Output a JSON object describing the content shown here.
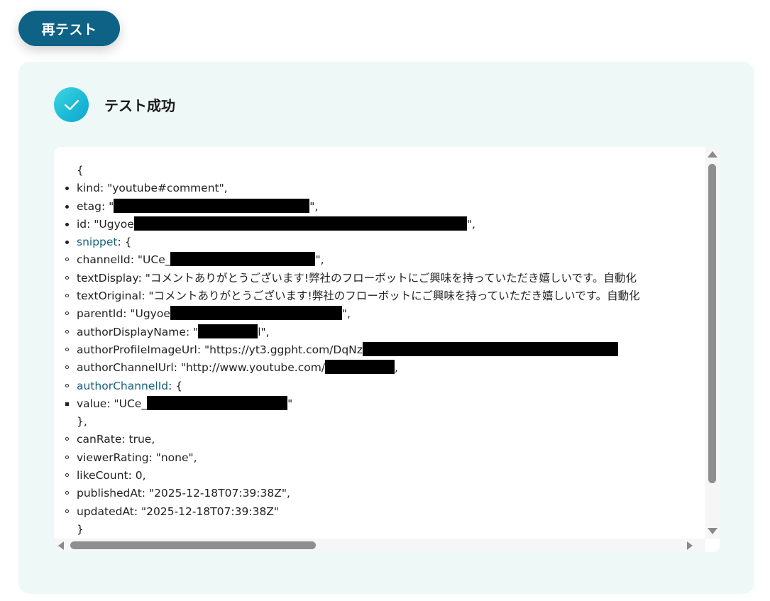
{
  "retest_button": {
    "label": "再テスト"
  },
  "status": {
    "text": "テスト成功"
  },
  "json": {
    "open_brace": "{",
    "kind": "kind: \"youtube#comment\",",
    "etag_prefix": "etag: \"",
    "etag_suffix": "\",",
    "id_prefix": "id: \"Ugyoe",
    "id_suffix": "\",",
    "snippet_key": "snippet",
    "snippet_open": ": {",
    "channelId_prefix": "channelId: \"UCe_",
    "channelId_suffix": "\",",
    "textDisplay": "textDisplay: \"コメントありがとうございます!弊社のフローボットにご興味を持っていただき嬉しいです。自動化",
    "textOriginal": "textOriginal: \"コメントありがとうございます!弊社のフローボットにご興味を持っていただき嬉しいです。自動化",
    "parentId_prefix": "parentId: \"Ugyoe",
    "parentId_suffix": "\",",
    "authorDisplayName_prefix": "authorDisplayName: \"",
    "authorDisplayName_suffix": "l\",",
    "authorProfileImageUrl_prefix": "authorProfileImageUrl: \"https://yt3.ggpht.com/DqNz",
    "authorChannelUrl_prefix": "authorChannelUrl: \"http://www.youtube.com/",
    "authorChannelUrl_suffix": ",",
    "authorChannelId_key": "authorChannelId",
    "authorChannelId_open": ": {",
    "value_prefix": "value: \"UCe_",
    "value_suffix": "\"",
    "inner_close": "},",
    "canRate": "canRate: true,",
    "viewerRating": "viewerRating: \"none\",",
    "likeCount": "likeCount: 0,",
    "publishedAt": "publishedAt: \"2025-12-18T07:39:38Z\",",
    "updatedAt": "updatedAt: \"2025-12-18T07:39:38Z\"",
    "snippet_close": "}"
  },
  "icons": {
    "check": "check-icon",
    "scroll_up": "triangle-up-icon",
    "scroll_down": "triangle-down-icon",
    "scroll_left": "triangle-left-icon",
    "scroll_right": "triangle-right-icon"
  },
  "colors": {
    "button_bg": "#0e6286",
    "panel_bg": "#eef8f7",
    "link_key": "#15607e",
    "check_gradient_start": "#3fd6df",
    "check_gradient_end": "#13a5cc"
  }
}
